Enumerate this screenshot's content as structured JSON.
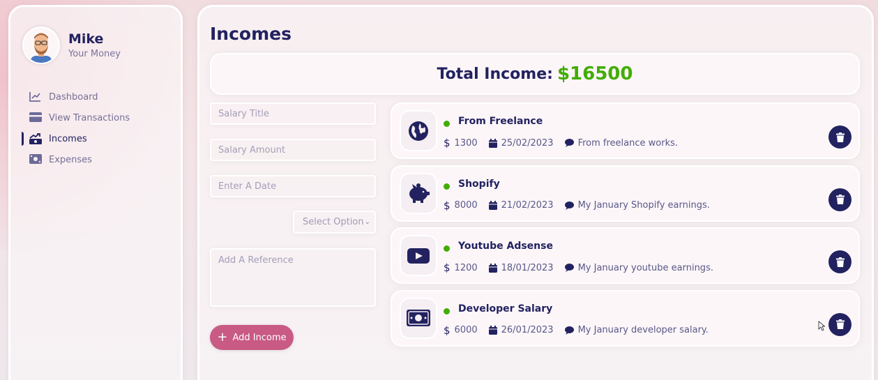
{
  "profile": {
    "name": "Mike",
    "subtitle": "Your Money"
  },
  "menu": [
    {
      "label": "Dashboard",
      "icon": "chart-line-icon",
      "active": false
    },
    {
      "label": "View Transactions",
      "icon": "credit-card-icon",
      "active": false
    },
    {
      "label": "Incomes",
      "icon": "money-bill-trend-icon",
      "active": true
    },
    {
      "label": "Expenses",
      "icon": "money-bill-icon",
      "active": false
    }
  ],
  "page": {
    "title": "Incomes"
  },
  "total": {
    "label": "Total Income:",
    "amount": "$16500",
    "amount_color": "#42ad00"
  },
  "form": {
    "title_placeholder": "Salary Title",
    "amount_placeholder": "Salary Amount",
    "date_placeholder": "Enter A Date",
    "select_value": "Select Option",
    "reference_placeholder": "Add A Reference",
    "add_button_label": "Add Income"
  },
  "incomes": [
    {
      "title": "From Freelance",
      "icon": "globe-icon",
      "amount": "1300",
      "date": "25/02/2023",
      "description": "From freelance works."
    },
    {
      "title": "Shopify",
      "icon": "piggy-bank-icon",
      "amount": "8000",
      "date": "21/02/2023",
      "description": "My January Shopify earnings."
    },
    {
      "title": "Youtube Adsense",
      "icon": "youtube-icon",
      "amount": "1200",
      "date": "18/01/2023",
      "description": "My January youtube earnings."
    },
    {
      "title": "Developer Salary",
      "icon": "money-bill-icon",
      "amount": "6000",
      "date": "26/01/2023",
      "description": "My January developer salary."
    }
  ],
  "colors": {
    "primary": "#222260",
    "accent": "#c85a84",
    "income_green": "#42ad00"
  }
}
